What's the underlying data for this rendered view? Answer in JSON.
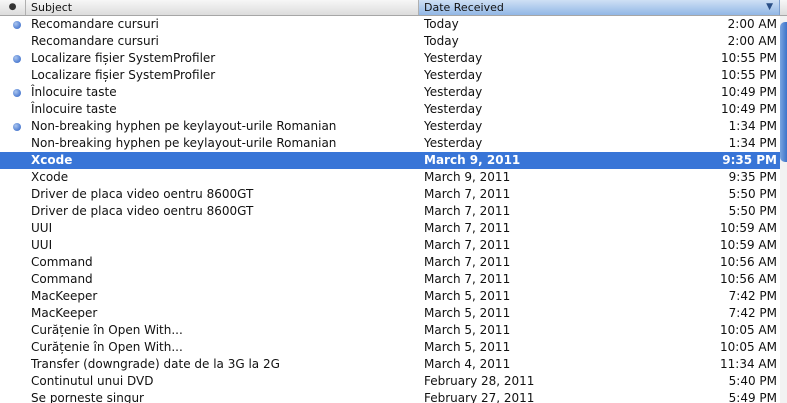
{
  "header": {
    "status_glyph": "●",
    "subject_label": "Subject",
    "date_label": "Date Received",
    "sort_glyph": "▼"
  },
  "rows": [
    {
      "subject": "Recomandare cursuri",
      "date": "Today",
      "time": "2:00 AM",
      "unread": true,
      "selected": false
    },
    {
      "subject": "Recomandare cursuri",
      "date": "Today",
      "time": "2:00 AM",
      "unread": false,
      "selected": false
    },
    {
      "subject": "Localizare fișier SystemProfiler",
      "date": "Yesterday",
      "time": "10:55 PM",
      "unread": true,
      "selected": false
    },
    {
      "subject": "Localizare fișier SystemProfiler",
      "date": "Yesterday",
      "time": "10:55 PM",
      "unread": false,
      "selected": false
    },
    {
      "subject": "Înlocuire taste",
      "date": "Yesterday",
      "time": "10:49 PM",
      "unread": true,
      "selected": false
    },
    {
      "subject": "Înlocuire taste",
      "date": "Yesterday",
      "time": "10:49 PM",
      "unread": false,
      "selected": false
    },
    {
      "subject": "Non-breaking hyphen pe keylayout-urile Romanian",
      "date": "Yesterday",
      "time": "1:34 PM",
      "unread": true,
      "selected": false
    },
    {
      "subject": "Non-breaking hyphen pe keylayout-urile Romanian",
      "date": "Yesterday",
      "time": "1:34 PM",
      "unread": false,
      "selected": false
    },
    {
      "subject": "Xcode",
      "date": "March 9, 2011",
      "time": "9:35 PM",
      "unread": false,
      "selected": true
    },
    {
      "subject": "Xcode",
      "date": "March 9, 2011",
      "time": "9:35 PM",
      "unread": false,
      "selected": false
    },
    {
      "subject": "Driver de placa video oentru 8600GT",
      "date": "March 7, 2011",
      "time": "5:50 PM",
      "unread": false,
      "selected": false
    },
    {
      "subject": "Driver de placa video oentru 8600GT",
      "date": "March 7, 2011",
      "time": "5:50 PM",
      "unread": false,
      "selected": false
    },
    {
      "subject": "UUI",
      "date": "March 7, 2011",
      "time": "10:59 AM",
      "unread": false,
      "selected": false
    },
    {
      "subject": "UUI",
      "date": "March 7, 2011",
      "time": "10:59 AM",
      "unread": false,
      "selected": false
    },
    {
      "subject": "Command",
      "date": "March 7, 2011",
      "time": "10:56 AM",
      "unread": false,
      "selected": false
    },
    {
      "subject": "Command",
      "date": "March 7, 2011",
      "time": "10:56 AM",
      "unread": false,
      "selected": false
    },
    {
      "subject": "MacKeeper",
      "date": "March 5, 2011",
      "time": "7:42 PM",
      "unread": false,
      "selected": false
    },
    {
      "subject": "MacKeeper",
      "date": "March 5, 2011",
      "time": "7:42 PM",
      "unread": false,
      "selected": false
    },
    {
      "subject": "Curățenie în Open With...",
      "date": "March 5, 2011",
      "time": "10:05 AM",
      "unread": false,
      "selected": false
    },
    {
      "subject": "Curățenie în Open With...",
      "date": "March 5, 2011",
      "time": "10:05 AM",
      "unread": false,
      "selected": false
    },
    {
      "subject": "Transfer (downgrade) date de la 3G la 2G",
      "date": "March 4, 2011",
      "time": "11:34 AM",
      "unread": false,
      "selected": false
    },
    {
      "subject": "Continutul unui DVD",
      "date": "February 28, 2011",
      "time": "5:40 PM",
      "unread": false,
      "selected": false
    },
    {
      "subject": "Se porneste singur",
      "date": "February 27, 2011",
      "time": "5:49 PM",
      "unread": false,
      "selected": false
    }
  ],
  "colors": {
    "selection": "#3875d7",
    "unread_dot": "#5a86d6",
    "sorted_header": "#92b7e6"
  }
}
